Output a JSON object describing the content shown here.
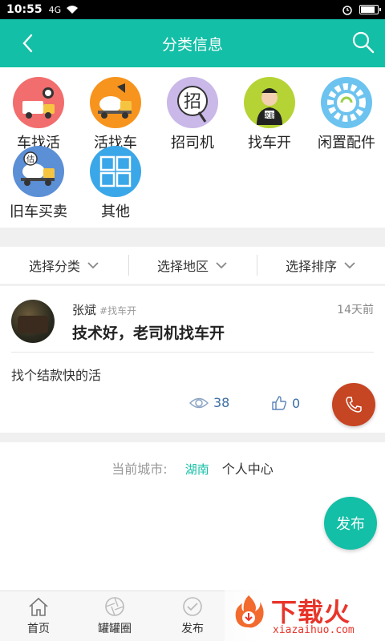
{
  "status_bar": {
    "time": "10:55",
    "network": "4G"
  },
  "header": {
    "title": "分类信息",
    "colors": {
      "accent": "#13bfa6"
    }
  },
  "categories": [
    {
      "label": "车找活",
      "icon": "truck-worker-icon",
      "color": "#f26d6d"
    },
    {
      "label": "活找车",
      "icon": "mixer-truck-icon",
      "color": "#f7941d"
    },
    {
      "label": "招司机",
      "icon": "recruit-icon",
      "color": "#c9b8e8"
    },
    {
      "label": "找车开",
      "icon": "driver-icon",
      "color": "#b5d334"
    },
    {
      "label": "闲置配件",
      "icon": "gear-icon",
      "color": "#6cc3ef"
    },
    {
      "label": "旧车买卖",
      "icon": "used-truck-icon",
      "color": "#5b8fd6"
    },
    {
      "label": "其他",
      "icon": "grid-icon",
      "color": "#3aa7e8"
    }
  ],
  "filters": [
    {
      "label": "选择分类"
    },
    {
      "label": "选择地区"
    },
    {
      "label": "选择排序"
    }
  ],
  "post": {
    "user": "张斌",
    "tag": "#找车开",
    "time": "14天前",
    "title": "技术好，老司机找车开",
    "body": "找个结款快的活",
    "views": "38",
    "likes": "0"
  },
  "footer": {
    "city_label": "当前城市:",
    "city": "湖南",
    "personal_center": "个人中心",
    "publish": "发布"
  },
  "bottom_nav": [
    {
      "label": "首页",
      "icon": "home-icon"
    },
    {
      "label": "罐罐圈",
      "icon": "aperture-icon"
    },
    {
      "label": "发布",
      "icon": "check-circle-icon"
    }
  ],
  "watermark": {
    "text": "下载火",
    "url": "xiazaihuo.com"
  }
}
